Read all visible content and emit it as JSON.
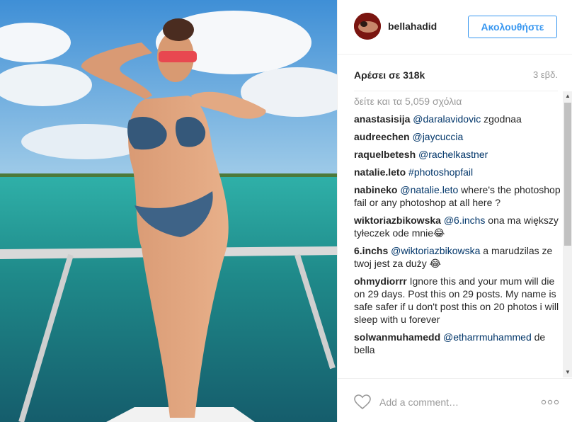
{
  "post": {
    "username": "bellahadid",
    "follow_label": "Ακολουθήστε",
    "likes": "Αρέσει σε 318k",
    "timestamp": "3 εβδ.",
    "view_all_comments": "δείτε και τα 5,059 σχόλια"
  },
  "comments": [
    {
      "user": "anastasisija",
      "mention": "@daralavidovic",
      "text": " zgodnaa"
    },
    {
      "user": "audreechen",
      "mention": "@jaycuccia",
      "text": ""
    },
    {
      "user": "raquelbetesh",
      "mention": "@rachelkastner",
      "text": ""
    },
    {
      "user": "natalie.leto",
      "mention": "#photoshopfail",
      "text": ""
    },
    {
      "user": "nabineko",
      "mention": "@natalie.leto",
      "text": " where's the photoshop fail or any photoshop at all here ?"
    },
    {
      "user": "wiktoriazbikowska",
      "mention": "@6.inchs",
      "text": " ona ma większy tyłeczek ode mnie😂"
    },
    {
      "user": "6.inchs",
      "mention": "@wiktoriazbikowska",
      "text": " a marudzilas ze twoj jest za duży 😂"
    },
    {
      "user": "ohmydiorrr",
      "mention": "",
      "text": "Ignore this and your mum will die on 29 days. Post this on 29 posts. My name is safe safer if u don't post this on 20 photos i will sleep with u forever"
    },
    {
      "user": "solwanmuhamedd",
      "mention": "@etharrmuhammed",
      "text": " de bella"
    }
  ],
  "footer": {
    "comment_placeholder": "Add a comment…",
    "like_icon": "heart-outline-icon",
    "more_icon": "ellipsis-icon"
  },
  "colors": {
    "accent": "#3897f0",
    "link": "#003569",
    "muted": "#999999"
  }
}
